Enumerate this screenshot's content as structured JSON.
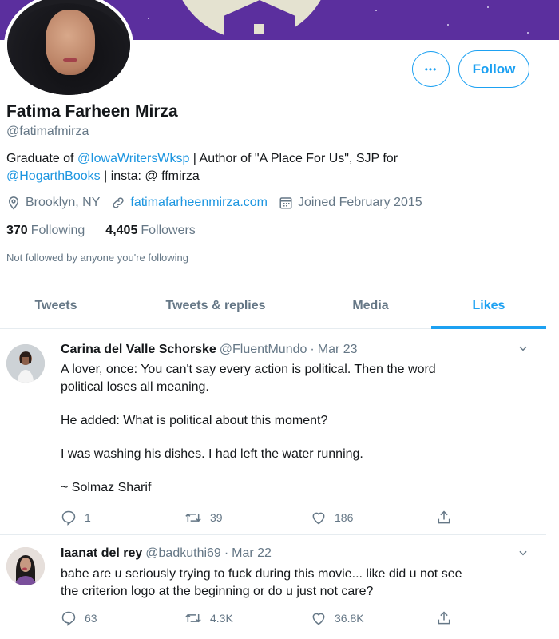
{
  "profile": {
    "name": "Fatima Farheen Mirza",
    "handle": "@fatimafmirza",
    "bio": {
      "part1": "Graduate of ",
      "mention1": "@IowaWritersWksp",
      "part2": " | Author of \"A Place For Us\", SJP for ",
      "mention2": "@HogarthBooks",
      "part3": " | insta: @ ffmirza"
    },
    "location": "Brooklyn, NY",
    "website": "fatimafarheenmirza.com",
    "joined": "Joined February 2015",
    "following_count": "370",
    "following_label": "Following",
    "followers_count": "4,405",
    "followers_label": "Followers",
    "not_followed_text": "Not followed by anyone you're following"
  },
  "buttons": {
    "more_glyph": "•••",
    "follow_label": "Follow"
  },
  "tabs": [
    {
      "label": "Tweets"
    },
    {
      "label": "Tweets & replies"
    },
    {
      "label": "Media"
    },
    {
      "label": "Likes"
    }
  ],
  "tweets": [
    {
      "author": "Carina del Valle Schorske",
      "handle": "@FluentMundo",
      "sep": "·",
      "date": "Mar 23",
      "lines": [
        "A lover, once: You can't say every action is political. Then the word",
        "political loses all meaning.",
        "",
        "He added: What is political about this moment?",
        "",
        "I was washing his dishes. I had left the water running.",
        "",
        "~ Solmaz Sharif"
      ],
      "replies": "1",
      "retweets": "39",
      "likes": "186"
    },
    {
      "author": "Iaanat del rey",
      "handle": "@badkuthi69",
      "sep": "·",
      "date": "Mar 22",
      "lines": [
        "babe are u seriously trying to fuck during this movie... like did u not see",
        "the criterion logo at the beginning or do  u just not care?"
      ],
      "replies": "63",
      "retweets": "4.3K",
      "likes": "36.8K"
    }
  ],
  "icons": {
    "location": "location-pin-icon",
    "website": "link-icon",
    "joined": "calendar-icon",
    "reply": "reply-icon",
    "retweet": "retweet-icon",
    "like": "heart-icon",
    "share": "share-icon",
    "caret": "chevron-down-icon"
  },
  "colors": {
    "accent": "#1da1f2",
    "banner": "#5b2f9e",
    "secondary_text": "#657786"
  }
}
